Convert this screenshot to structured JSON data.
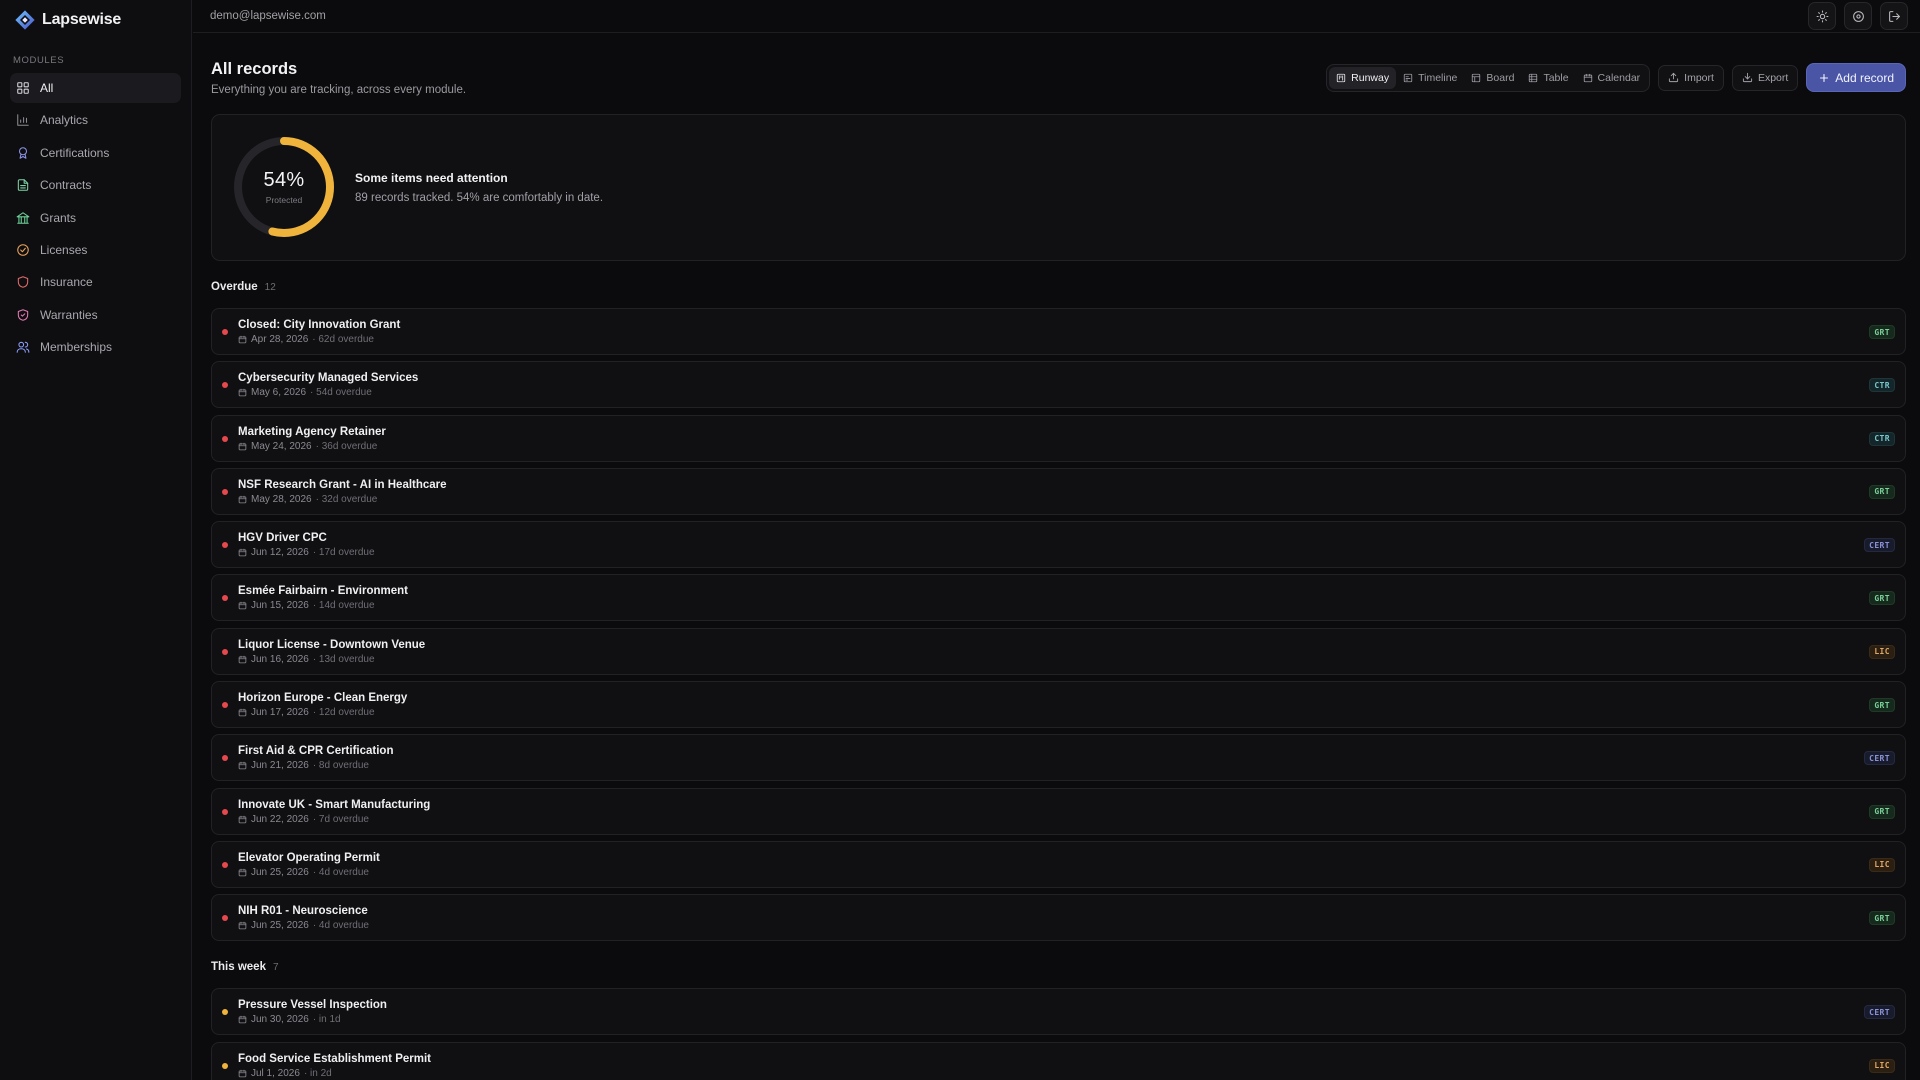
{
  "brand": {
    "name": "Lapsewise"
  },
  "sidebar": {
    "section_label": "Modules",
    "items": [
      {
        "label": "All",
        "icon": "grid-icon",
        "active": true
      },
      {
        "label": "Analytics",
        "icon": "bar-chart-icon"
      },
      {
        "label": "Certifications",
        "icon": "award-icon"
      },
      {
        "label": "Contracts",
        "icon": "file-text-icon"
      },
      {
        "label": "Grants",
        "icon": "landmark-icon"
      },
      {
        "label": "Licenses",
        "icon": "badge-check-icon"
      },
      {
        "label": "Insurance",
        "icon": "shield-icon"
      },
      {
        "label": "Warranties",
        "icon": "shield-check-icon"
      },
      {
        "label": "Memberships",
        "icon": "users-icon"
      }
    ]
  },
  "topbar": {
    "email": "demo@lapsewise.com",
    "actions": [
      "sun-icon",
      "settings-icon",
      "logout-icon"
    ]
  },
  "header": {
    "title": "All records",
    "subtitle": "Everything you are tracking, across every module.",
    "views": [
      {
        "label": "Runway",
        "icon": "kanban-icon",
        "active": true
      },
      {
        "label": "Timeline",
        "icon": "timeline-icon"
      },
      {
        "label": "Board",
        "icon": "board-icon"
      },
      {
        "label": "Table",
        "icon": "table-icon"
      },
      {
        "label": "Calendar",
        "icon": "calendar-icon"
      }
    ],
    "import_label": "Import",
    "export_label": "Export",
    "add_label": "Add record"
  },
  "summary": {
    "percent": 54,
    "percent_label": "54%",
    "ring_label": "Protected",
    "title": "Some items need attention",
    "description": "89 records tracked. 54% are comfortably in date.",
    "ring_color": "#f0b43c",
    "track_color": "#26262a"
  },
  "sections": [
    {
      "title": "Overdue",
      "count": "12",
      "dot_color": "#e5484d",
      "rows": [
        {
          "title": "Closed: City Innovation Grant",
          "date": "Apr 28, 2026",
          "status": "· 62d overdue",
          "tag": "GRT"
        },
        {
          "title": "Cybersecurity Managed Services",
          "date": "May 6, 2026",
          "status": "· 54d overdue",
          "tag": "CTR"
        },
        {
          "title": "Marketing Agency Retainer",
          "date": "May 24, 2026",
          "status": "· 36d overdue",
          "tag": "CTR"
        },
        {
          "title": "NSF Research Grant - AI in Healthcare",
          "date": "May 28, 2026",
          "status": "· 32d overdue",
          "tag": "GRT"
        },
        {
          "title": "HGV Driver CPC",
          "date": "Jun 12, 2026",
          "status": "· 17d overdue",
          "tag": "CERT"
        },
        {
          "title": "Esmée Fairbairn - Environment",
          "date": "Jun 15, 2026",
          "status": "· 14d overdue",
          "tag": "GRT"
        },
        {
          "title": "Liquor License - Downtown Venue",
          "date": "Jun 16, 2026",
          "status": "· 13d overdue",
          "tag": "LIC"
        },
        {
          "title": "Horizon Europe - Clean Energy",
          "date": "Jun 17, 2026",
          "status": "· 12d overdue",
          "tag": "GRT"
        },
        {
          "title": "First Aid & CPR Certification",
          "date": "Jun 21, 2026",
          "status": "· 8d overdue",
          "tag": "CERT"
        },
        {
          "title": "Innovate UK - Smart Manufacturing",
          "date": "Jun 22, 2026",
          "status": "· 7d overdue",
          "tag": "GRT"
        },
        {
          "title": "Elevator Operating Permit",
          "date": "Jun 25, 2026",
          "status": "· 4d overdue",
          "tag": "LIC"
        },
        {
          "title": "NIH R01 - Neuroscience",
          "date": "Jun 25, 2026",
          "status": "· 4d overdue",
          "tag": "GRT"
        }
      ]
    },
    {
      "title": "This week",
      "count": "7",
      "dot_color": "#f0b43c",
      "rows": [
        {
          "title": "Pressure Vessel Inspection",
          "date": "Jun 30, 2026",
          "status": "· in 1d",
          "tag": "CERT"
        },
        {
          "title": "Food Service Establishment Permit",
          "date": "Jul 1, 2026",
          "status": "· in 2d",
          "tag": "LIC"
        }
      ]
    }
  ]
}
